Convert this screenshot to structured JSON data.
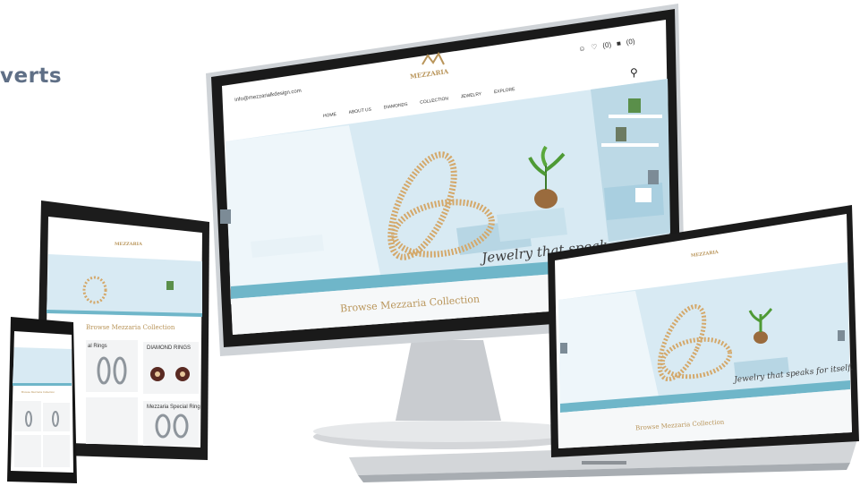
{
  "page": {
    "heading_fragment": "verts"
  },
  "brand": {
    "name": "MEZZARIA",
    "gold": "#b9955a",
    "sky": "#cfe5ef",
    "teal": "#6fb6c9"
  },
  "desktop": {
    "email": "info@mezzarialkdesign.com",
    "nav": [
      "HOME",
      "ABOUT US",
      "DIAMONDS",
      "COLLECTION",
      "JEWELRY",
      "EXPLORE"
    ],
    "header_counts": {
      "wishlist": "(0)",
      "cart": "(0)"
    },
    "hero_tagline": "Jewelry that speak",
    "browse_label": "Browse Mezzaria Collection"
  },
  "laptop": {
    "hero_tagline": "Jewelry that speaks for itself.",
    "browse_label": "Browse Mezzaria Collection"
  },
  "tablet": {
    "browse_label": "Browse Mezzaria Collection",
    "products": [
      {
        "name": "DIAMOND RINGS"
      },
      {
        "name": "Mezzaria Special Ring"
      }
    ],
    "partial_label": "al Rings"
  },
  "phone": {
    "browse_label": "Browse Mezzaria Collection"
  },
  "icons": [
    "user-icon",
    "heart-icon",
    "bag-icon",
    "search-icon",
    "chevron-left-icon",
    "chevron-right-icon"
  ]
}
